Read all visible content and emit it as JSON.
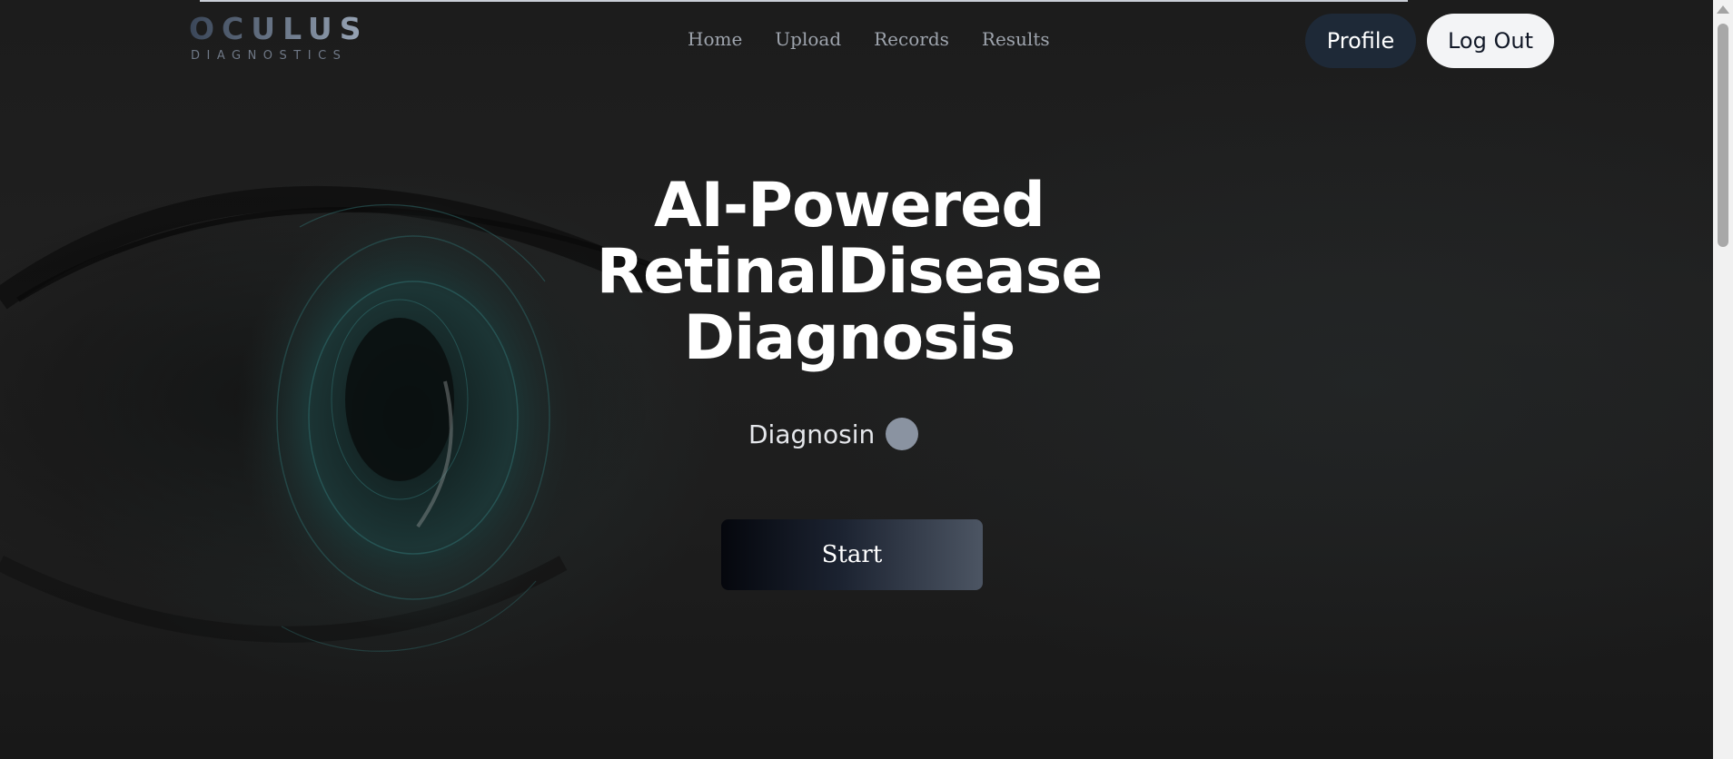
{
  "logo": {
    "main": "OCULUS",
    "sub": "DIAGNOSTICS"
  },
  "nav": {
    "links": [
      "Home",
      "Upload",
      "Records",
      "Results"
    ],
    "profile_label": "Profile",
    "logout_label": "Log Out"
  },
  "hero": {
    "title_lines": [
      "AI-Powered",
      "RetinalDisease",
      "Diagnosis"
    ],
    "status_text": "Diagnosin",
    "start_label": "Start"
  },
  "colors": {
    "background": "#1c1c1c",
    "profile_button": "#1e2937",
    "logout_button": "#f3f4f6",
    "status_dot": "#8a93a1",
    "accent_eye": "#2f6f6f"
  },
  "icons": {
    "scroll_up": "triangle-up"
  }
}
